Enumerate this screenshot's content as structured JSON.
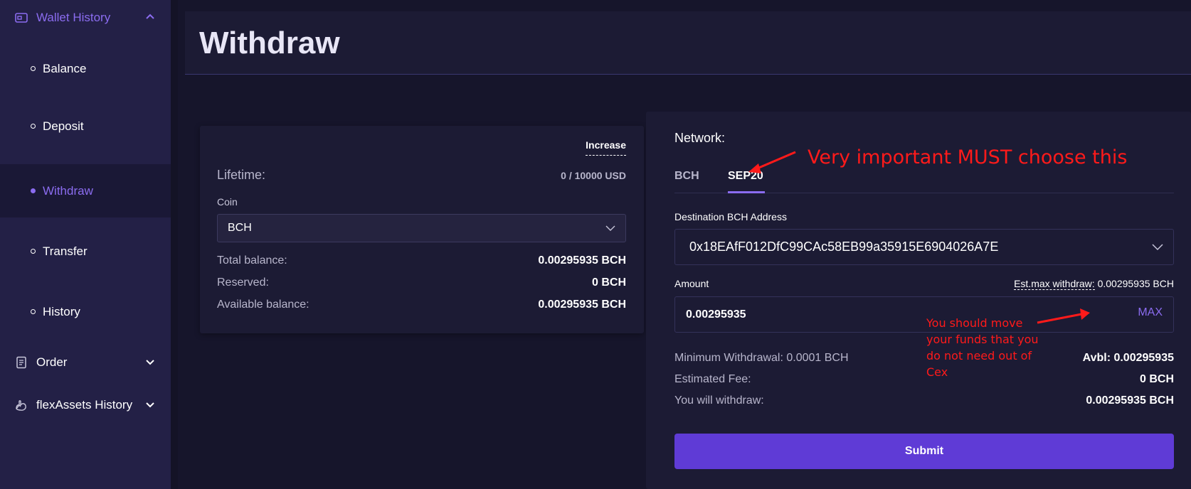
{
  "sidebar": {
    "section_title": "Wallet History",
    "items": [
      {
        "label": "Balance"
      },
      {
        "label": "Deposit"
      },
      {
        "label": "Withdraw",
        "active": true
      },
      {
        "label": "Transfer"
      },
      {
        "label": "History"
      }
    ],
    "groups": [
      {
        "label": "Order",
        "icon": "document-icon"
      },
      {
        "label": "flexAssets History",
        "icon": "hand-icon"
      }
    ]
  },
  "page": {
    "title": "Withdraw"
  },
  "limits_card": {
    "increase_link": "Increase",
    "lifetime_label": "Lifetime:",
    "lifetime_value": "0 / 10000 USD",
    "coin_label": "Coin",
    "coin_selected": "BCH",
    "total_balance_label": "Total balance:",
    "total_balance_value": "0.00295935 BCH",
    "reserved_label": "Reserved:",
    "reserved_value": "0 BCH",
    "available_label": "Available balance:",
    "available_value": "0.00295935 BCH"
  },
  "withdraw_form": {
    "network_label": "Network:",
    "tabs": [
      {
        "label": "BCH"
      },
      {
        "label": "SEP20",
        "active": true
      }
    ],
    "destination_label": "Destination BCH Address",
    "destination_value": "0x18EAfF012DfC99CAc58EB99a35915E6904026A7E",
    "amount_label": "Amount",
    "est_max_label": "Est.max withdraw:",
    "est_max_value": "0.00295935 BCH",
    "amount_value": "0.00295935",
    "max_button": "MAX",
    "min_withdrawal": "Minimum Withdrawal: 0.0001 BCH",
    "avbl": "Avbl: 0.00295935",
    "est_fee_label": "Estimated Fee:",
    "est_fee_value": "0 BCH",
    "you_withdraw_label": "You will withdraw:",
    "you_withdraw_value": "0.00295935 BCH",
    "submit_label": "Submit"
  },
  "annotations": {
    "network_note": "Very important MUST choose this",
    "max_note": "You should move your funds that you do not need out of Cex",
    "color": "#ff1a1a"
  },
  "colors": {
    "accent": "#8b6cf0",
    "submit": "#5f3bd6",
    "sidebar_bg": "#232046",
    "panel_bg": "#1c1b34",
    "page_bg": "#16152b"
  }
}
